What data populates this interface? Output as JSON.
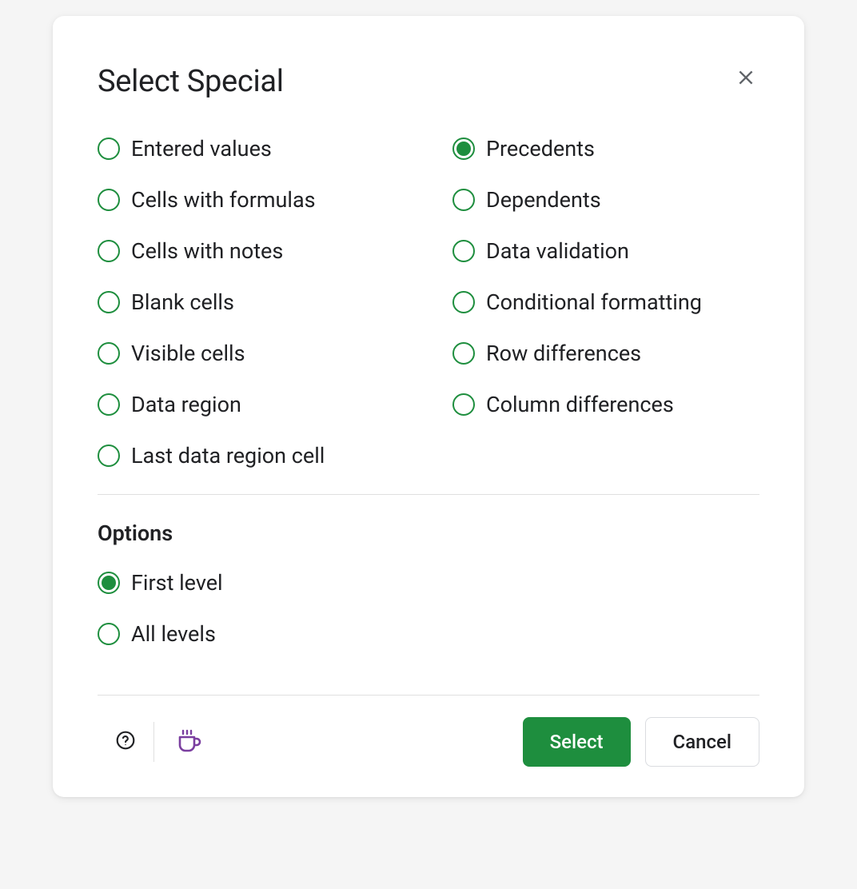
{
  "dialog": {
    "title": "Select Special",
    "selection_types": {
      "left": [
        {
          "id": "entered-values",
          "label": "Entered values",
          "selected": false
        },
        {
          "id": "cells-formulas",
          "label": "Cells with formulas",
          "selected": false
        },
        {
          "id": "cells-notes",
          "label": "Cells with notes",
          "selected": false
        },
        {
          "id": "blank-cells",
          "label": "Blank cells",
          "selected": false
        },
        {
          "id": "visible-cells",
          "label": "Visible cells",
          "selected": false
        },
        {
          "id": "data-region",
          "label": "Data region",
          "selected": false
        },
        {
          "id": "last-data-region",
          "label": "Last data region cell",
          "selected": false
        }
      ],
      "right": [
        {
          "id": "precedents",
          "label": "Precedents",
          "selected": true
        },
        {
          "id": "dependents",
          "label": "Dependents",
          "selected": false
        },
        {
          "id": "data-validation",
          "label": "Data validation",
          "selected": false
        },
        {
          "id": "conditional-formatting",
          "label": "Conditional formatting",
          "selected": false
        },
        {
          "id": "row-differences",
          "label": "Row differences",
          "selected": false
        },
        {
          "id": "column-differences",
          "label": "Column differences",
          "selected": false
        }
      ]
    },
    "options": {
      "title": "Options",
      "items": [
        {
          "id": "first-level",
          "label": "First level",
          "selected": true
        },
        {
          "id": "all-levels",
          "label": "All levels",
          "selected": false
        }
      ]
    },
    "buttons": {
      "select": "Select",
      "cancel": "Cancel"
    }
  }
}
